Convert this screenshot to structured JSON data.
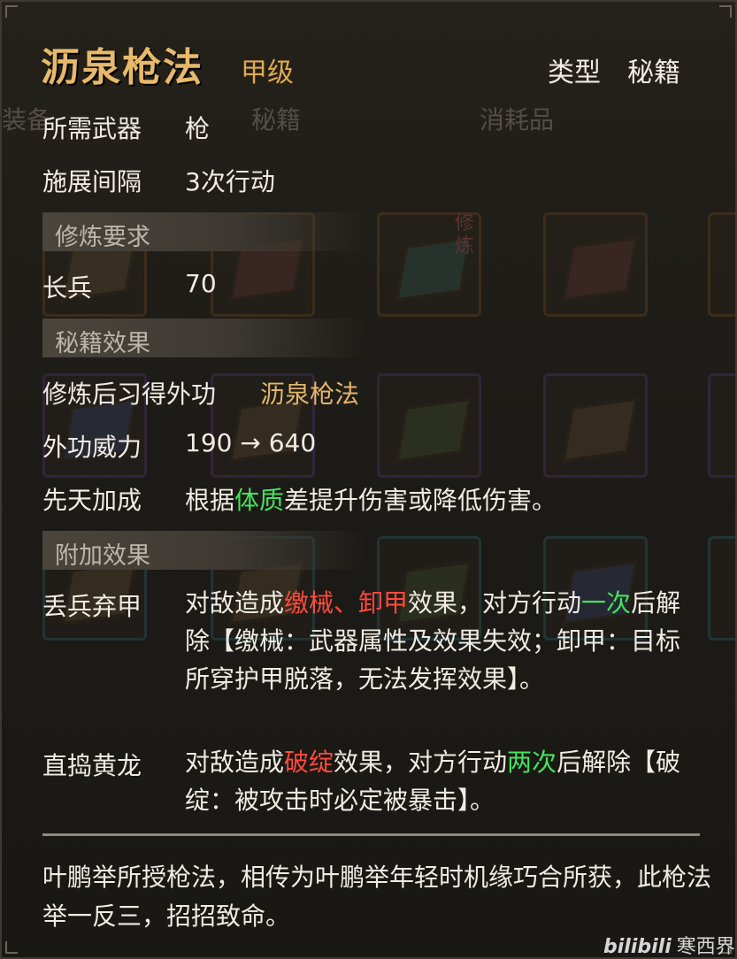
{
  "item": {
    "name": "沥泉枪法",
    "grade": "甲级",
    "type_label": "类型",
    "type_value": "秘籍"
  },
  "background": {
    "tabs": [
      "装备",
      "秘籍",
      "消耗品"
    ],
    "badge": "修炼"
  },
  "stats": [
    {
      "label": "所需武器",
      "value": "枪"
    },
    {
      "label": "施展间隔",
      "value": "3次行动"
    }
  ],
  "requirement": {
    "section": "修炼要求",
    "label": "长兵",
    "value": "70"
  },
  "effects": {
    "section": "秘籍效果",
    "learn_label": "修炼后习得外功",
    "learn_value": "沥泉枪法",
    "power_label": "外功威力",
    "power_value": "190 → 640",
    "innate_label": "先天加成",
    "innate_pre": "根据",
    "innate_stat": "体质",
    "innate_post": "差提升伤害或降低伤害。"
  },
  "extra": {
    "section": "附加效果",
    "effect1": {
      "label": "丢兵弃甲",
      "t1": "对敌造成",
      "k1": "缴械、卸甲",
      "t2": "效果，对方行动",
      "k2": "一次",
      "t3": "后解除【缴械：武器属性及效果失效；卸甲：目标所穿护甲脱落，无法发挥效果】。"
    },
    "effect2": {
      "label": "直捣黄龙",
      "t1": "对敌造成",
      "k1": "破绽",
      "t2": "效果，对方行动",
      "k2": "两次",
      "t3": "后解除【破绽：被攻击时必定被暴击】。"
    }
  },
  "lore": "叶鹏举所授枪法，相传为叶鹏举年轻时机缘巧合所获，此枪法举一反三，招招致命。",
  "watermark": {
    "logo": "bilibili",
    "user": "寒西界"
  },
  "colors": {
    "title": "#e7b96a",
    "grade": "#e0a94f",
    "debuff": "#ff4a3d",
    "duration": "#44e35f"
  }
}
